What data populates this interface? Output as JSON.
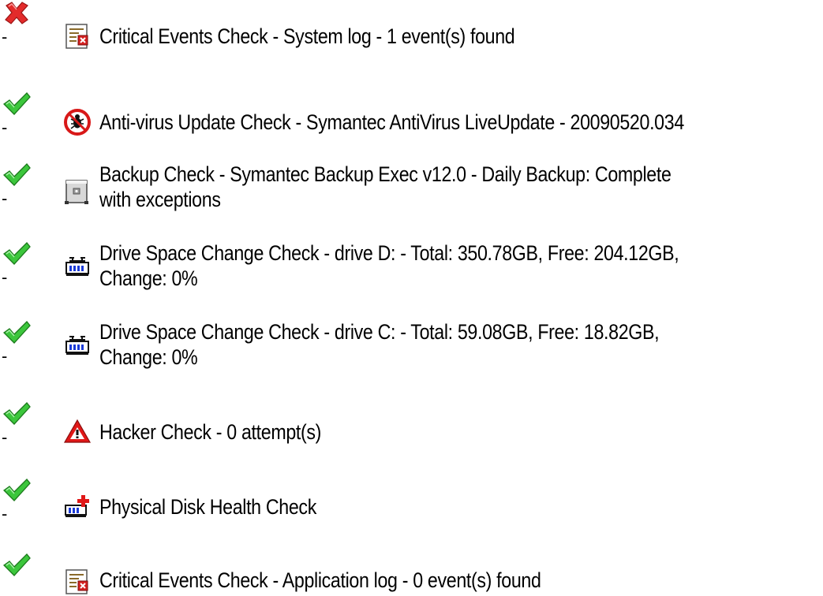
{
  "checks": [
    {
      "status": "fail",
      "status_icon": "red-x-icon",
      "dash": "-",
      "type_icon": "event-log-icon",
      "line1": "Critical Events Check - System log - 1 event(s) found",
      "line2": ""
    },
    {
      "status": "pass",
      "status_icon": "green-check-icon",
      "dash": "-",
      "type_icon": "antivirus-icon",
      "line1": "Anti-virus Update Check - Symantec AntiVirus LiveUpdate - 20090520.034",
      "line2": ""
    },
    {
      "status": "pass",
      "status_icon": "green-check-icon",
      "dash": "-",
      "type_icon": "backup-icon",
      "line1": "Backup Check - Symantec Backup Exec v12.0 - Daily Backup: Complete",
      "line2": "with exceptions"
    },
    {
      "status": "pass",
      "status_icon": "green-check-icon",
      "dash": "-",
      "type_icon": "drive-space-icon",
      "line1": "Drive Space Change Check - drive D: - Total: 350.78GB, Free: 204.12GB,",
      "line2": "Change: 0%"
    },
    {
      "status": "pass",
      "status_icon": "green-check-icon",
      "dash": "-",
      "type_icon": "drive-space-icon",
      "line1": "Drive Space Change Check - drive C: - Total: 59.08GB, Free: 18.82GB,",
      "line2": "Change: 0%"
    },
    {
      "status": "pass",
      "status_icon": "green-check-icon",
      "dash": "-",
      "type_icon": "warning-triangle-icon",
      "line1": "Hacker Check - 0 attempt(s)",
      "line2": ""
    },
    {
      "status": "pass",
      "status_icon": "green-check-icon",
      "dash": "-",
      "type_icon": "disk-health-icon",
      "line1": "Physical Disk Health Check",
      "line2": ""
    },
    {
      "status": "pass",
      "status_icon": "green-check-icon",
      "dash": "",
      "type_icon": "event-log-icon",
      "line1": "Critical Events Check - Application log - 0 event(s) found",
      "line2": ""
    }
  ],
  "colors": {
    "pass": "#2fb52f",
    "fail": "#e02020",
    "text": "#000000",
    "background": "#ffffff"
  }
}
